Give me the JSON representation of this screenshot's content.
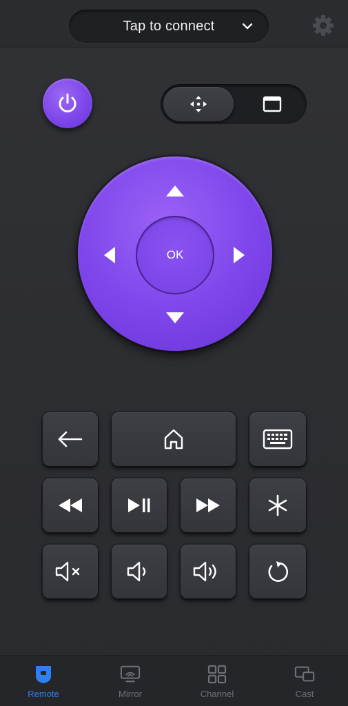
{
  "header": {
    "connect_label": "Tap to connect",
    "icons": {
      "dropdown": "chevron-down-icon",
      "settings": "gear-icon"
    }
  },
  "controls": {
    "power_icon": "power-icon",
    "mode_toggle": {
      "selected": "dpad",
      "options": [
        "move-arrows-icon",
        "touchpad-icon"
      ]
    }
  },
  "dpad": {
    "ok_label": "OK"
  },
  "keys": {
    "row1": [
      "back-arrow-icon",
      "home-icon",
      "keyboard-icon"
    ],
    "row2": [
      "rewind-icon",
      "play-pause-icon",
      "fast-forward-icon",
      "asterisk-icon"
    ],
    "row3": [
      "mute-icon",
      "volume-down-icon",
      "volume-up-icon",
      "replay-icon"
    ]
  },
  "nav": {
    "items": [
      {
        "label": "Remote",
        "icon": "remote-icon",
        "active": true
      },
      {
        "label": "Mirror",
        "icon": "mirror-icon",
        "active": false
      },
      {
        "label": "Channel",
        "icon": "channel-grid-icon",
        "active": false
      },
      {
        "label": "Cast",
        "icon": "cast-icon",
        "active": false
      }
    ]
  },
  "colors": {
    "accent": "#7b44e8",
    "active_nav": "#2f7ff0",
    "background": "#2e2f33",
    "key": "#38393e"
  }
}
